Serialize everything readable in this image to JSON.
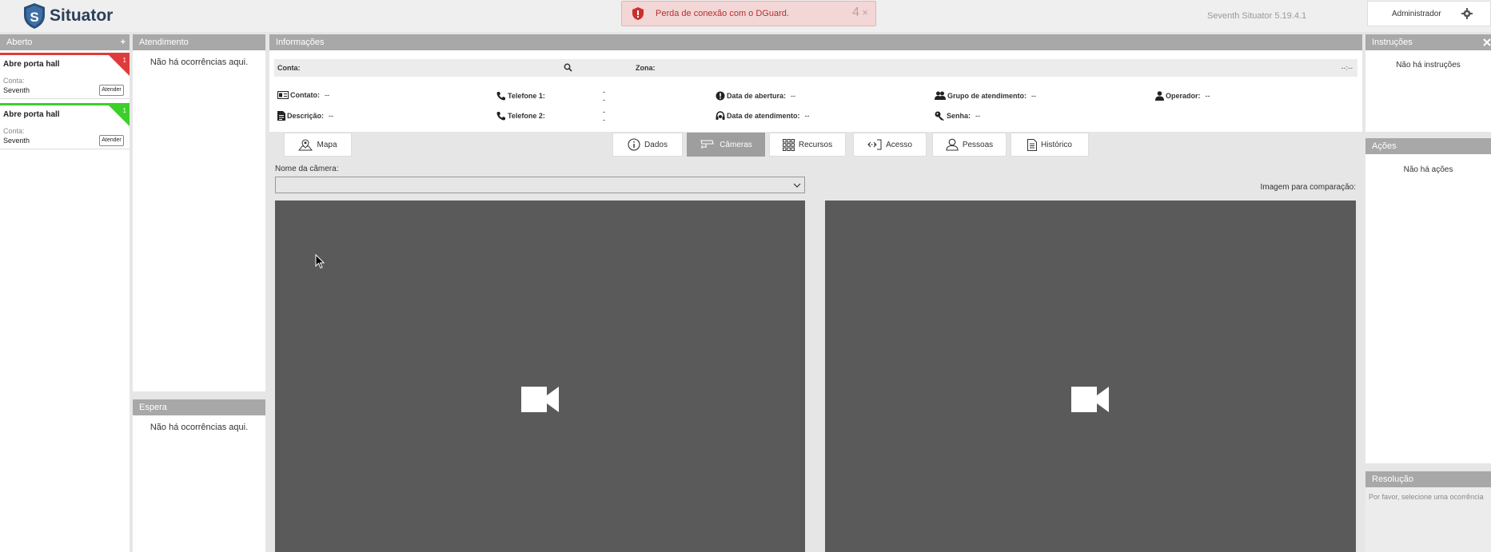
{
  "header": {
    "brand": "Situator",
    "version": "Seventh Situator 5.19.4.1",
    "user": "Administrador",
    "toast": {
      "message": "Perda de conexão com o DGuard.",
      "count": "4",
      "close": "×"
    }
  },
  "open_panel": {
    "title": "Aberto",
    "add": "+",
    "cards": [
      {
        "title": "Abre porta hall",
        "account_label": "Conta:",
        "account_value": "Seventh",
        "button": "Atender",
        "badge": "1",
        "color": "#e03b3b"
      },
      {
        "title": "Abre porta hall",
        "account_label": "Conta:",
        "account_value": "Seventh",
        "button": "Atender",
        "badge": "1",
        "color": "#3ccf2a"
      }
    ]
  },
  "attendance_panel": {
    "title": "Atendimento",
    "empty": "Não há ocorrências aqui."
  },
  "wait_panel": {
    "title": "Espera",
    "empty": "Não há ocorrências aqui."
  },
  "info_panel": {
    "title": "Informações",
    "account_label": "Conta:",
    "zone_label": "Zona:",
    "time": "--:--",
    "fields": {
      "contact": {
        "label": "Contato:",
        "value": "--"
      },
      "phone1": {
        "label": "Telefone 1:",
        "value": "--"
      },
      "opening_date": {
        "label": "Data de abertura:",
        "value": "--"
      },
      "service_group": {
        "label": "Grupo de atendimento:",
        "value": "--"
      },
      "operator": {
        "label": "Operador:",
        "value": "--"
      },
      "description": {
        "label": "Descrição:",
        "value": "--"
      },
      "phone2": {
        "label": "Telefone 2:",
        "value": "--"
      },
      "service_date": {
        "label": "Data de atendimento:",
        "value": "--"
      },
      "password": {
        "label": "Senha:",
        "value": "--"
      }
    }
  },
  "tabs": {
    "map": "Mapa",
    "data": "Dados",
    "cameras": "Câmeras",
    "resources": "Recursos",
    "access": "Acesso",
    "people": "Pessoas",
    "history": "Histórico"
  },
  "camera": {
    "name_label": "Nome da câmera:",
    "selected": "",
    "compare_label": "Imagem para comparação:"
  },
  "instructions_panel": {
    "title": "Instruções",
    "empty": "Não há instruções"
  },
  "actions_panel": {
    "title": "Ações",
    "empty": "Não há ações"
  },
  "resolution_panel": {
    "title": "Resolução",
    "placeholder": "Por favor, selecione uma ocorrência"
  }
}
